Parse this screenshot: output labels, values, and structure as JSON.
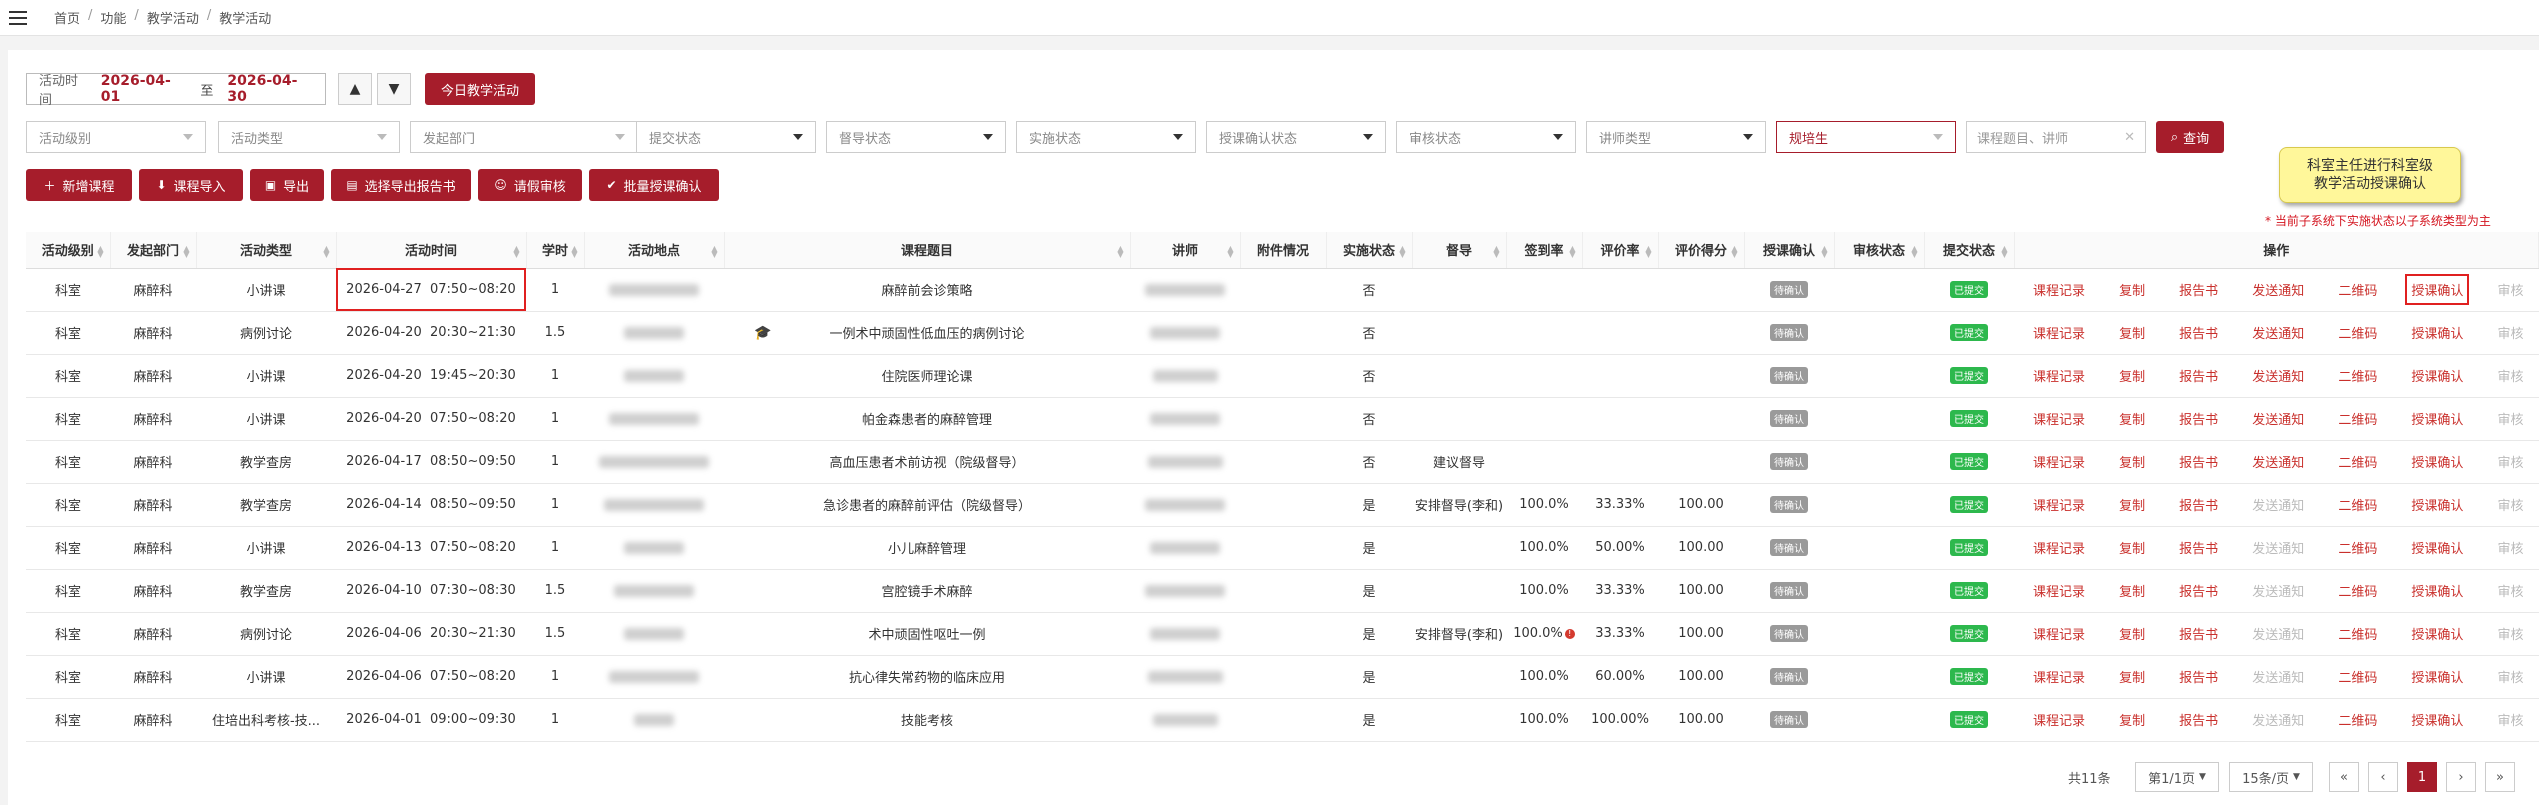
{
  "breadcrumb": [
    "首页",
    "功能",
    "教学活动",
    "教学活动"
  ],
  "filters": {
    "date_label": "活动时间",
    "date_from": "2026-04-01",
    "date_to_label": "至",
    "date_to": "2026-04-30",
    "today_button": "今日教学活动",
    "selects": [
      "活动级别",
      "活动类型",
      "发起部门",
      "提交状态",
      "督导状态",
      "实施状态",
      "授课确认状态",
      "审核状态",
      "讲师类型"
    ],
    "trainee_select": "规培生",
    "search_placeholder": "课程题目、讲师",
    "query_button": "查询"
  },
  "toolbar": {
    "add": "新增课程",
    "import": "课程导入",
    "export": "导出",
    "export_report": "选择导出报告书",
    "request_review": "请假审核",
    "batch_confirm": "批量授课确认"
  },
  "tooltip": [
    "科室主任进行科室级",
    "教学活动授课确认"
  ],
  "note": "* 当前子系统下实施状态以子系统类型为主",
  "columns": [
    "活动级别",
    "发起部门",
    "活动类型",
    "活动时间",
    "学时",
    "活动地点",
    "课程题目",
    "讲师",
    "附件情况",
    "实施状态",
    "督导",
    "签到率",
    "评价率",
    "评价得分",
    "授课确认",
    "审核状态",
    "提交状态",
    "操作"
  ],
  "badges": {
    "confirm": "待确认",
    "submit": "已提交"
  },
  "ops": [
    "课程记录",
    "复制",
    "报告书",
    "发送通知",
    "二维码",
    "授课确认",
    "审核"
  ],
  "rows": [
    {
      "level": "科室",
      "dept": "麻醉科",
      "type": "小讲课",
      "time": "2026-04-27  07:50~08:20",
      "hours": "1",
      "title": "麻醉前会诊策略",
      "status": "否",
      "supervise": "",
      "sign": "",
      "eval": "",
      "score": ""
    },
    {
      "level": "科室",
      "dept": "麻醉科",
      "type": "病例讨论",
      "time": "2026-04-20  20:30~21:30",
      "hours": "1.5",
      "title": "一例术中顽固性低血压的病例讨论",
      "status": "否",
      "supervise": "",
      "sign": "",
      "eval": "",
      "score": ""
    },
    {
      "level": "科室",
      "dept": "麻醉科",
      "type": "小讲课",
      "time": "2026-04-20  19:45~20:30",
      "hours": "1",
      "title": "住院医师理论课",
      "status": "否",
      "supervise": "",
      "sign": "",
      "eval": "",
      "score": ""
    },
    {
      "level": "科室",
      "dept": "麻醉科",
      "type": "小讲课",
      "time": "2026-04-20  07:50~08:20",
      "hours": "1",
      "title": "帕金森患者的麻醉管理",
      "status": "否",
      "supervise": "",
      "sign": "",
      "eval": "",
      "score": ""
    },
    {
      "level": "科室",
      "dept": "麻醉科",
      "type": "教学查房",
      "time": "2026-04-17  08:50~09:50",
      "hours": "1",
      "title": "高血压患者术前访视（院级督导）",
      "status": "否",
      "supervise": "建议督导",
      "sign": "",
      "eval": "",
      "score": ""
    },
    {
      "level": "科室",
      "dept": "麻醉科",
      "type": "教学查房",
      "time": "2026-04-14  08:50~09:50",
      "hours": "1",
      "title": "急诊患者的麻醉前评估（院级督导）",
      "status": "是",
      "supervise": "安排督导(李和)",
      "sign": "100.0%",
      "eval": "33.33%",
      "score": "100.00"
    },
    {
      "level": "科室",
      "dept": "麻醉科",
      "type": "小讲课",
      "time": "2026-04-13  07:50~08:20",
      "hours": "1",
      "title": "小儿麻醉管理",
      "status": "是",
      "supervise": "",
      "sign": "100.0%",
      "eval": "50.00%",
      "score": "100.00"
    },
    {
      "level": "科室",
      "dept": "麻醉科",
      "type": "教学查房",
      "time": "2026-04-10  07:30~08:30",
      "hours": "1.5",
      "title": "宫腔镜手术麻醉",
      "status": "是",
      "supervise": "",
      "sign": "100.0%",
      "eval": "33.33%",
      "score": "100.00"
    },
    {
      "level": "科室",
      "dept": "麻醉科",
      "type": "病例讨论",
      "time": "2026-04-06  20:30~21:30",
      "hours": "1.5",
      "title": "术中顽固性呕吐一例",
      "status": "是",
      "supervise": "安排督导(李和)",
      "sign": "100.0%",
      "eval": "33.33%",
      "score": "100.00"
    },
    {
      "level": "科室",
      "dept": "麻醉科",
      "type": "小讲课",
      "time": "2026-04-06  07:50~08:20",
      "hours": "1",
      "title": "抗心律失常药物的临床应用",
      "status": "是",
      "supervise": "",
      "sign": "100.0%",
      "eval": "60.00%",
      "score": "100.00"
    },
    {
      "level": "科室",
      "dept": "麻醉科",
      "type": "住培出科考核-技...",
      "time": "2026-04-01  09:00~09:30",
      "hours": "1",
      "title": "技能考核",
      "status": "是",
      "supervise": "",
      "sign": "100.0%",
      "eval": "100.00%",
      "score": "100.00"
    }
  ],
  "pager": {
    "total": "共11条",
    "page_select": "第1/1页",
    "size_select": "15条/页",
    "first": "«",
    "prev": "‹",
    "current": "1",
    "next": "›",
    "last": "»"
  }
}
